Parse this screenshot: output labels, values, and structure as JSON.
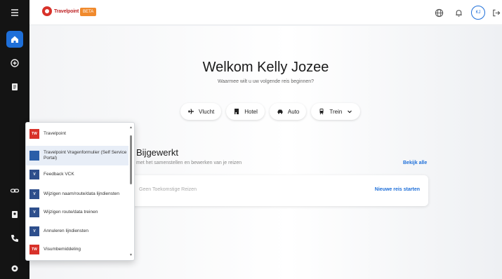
{
  "header": {
    "logo_text": "Travelpoint",
    "beta_badge": "BETA",
    "avatar_initials": "KJ"
  },
  "main": {
    "welcome": "Welkom Kelly Jozee",
    "subtitle": "Waarmee wilt u uw volgende reis beginnen?",
    "transport_options": [
      {
        "label": "Vlucht",
        "icon": "plane-icon"
      },
      {
        "label": "Hotel",
        "icon": "hotel-icon"
      },
      {
        "label": "Auto",
        "icon": "car-icon"
      },
      {
        "label": "Trein",
        "icon": "train-icon"
      }
    ],
    "section_title": "Bijgewerkt",
    "section_subtitle": "met het samenstellen en bewerken van je reizen",
    "view_all": "Bekijk alle",
    "trips_empty": "Geen Toekomstige Reizen",
    "new_trip": "Nieuwe reis starten"
  },
  "dropdown": {
    "items": [
      {
        "label": "Travelpoint",
        "icon": "TW",
        "color": "red"
      },
      {
        "label": "Travelpoint Vragenformulier (Self Service Portal)",
        "icon": "",
        "color": "blue"
      },
      {
        "label": "Feedback VCK",
        "icon": "V",
        "color": "navy"
      },
      {
        "label": "Wijzigen naam/route/data lijndiensten",
        "icon": "V",
        "color": "navy"
      },
      {
        "label": "Wijzigen route/data treinen",
        "icon": "V",
        "color": "navy"
      },
      {
        "label": "Annuleren lijndiensten",
        "icon": "V",
        "color": "navy"
      },
      {
        "label": "Visumbemiddeling",
        "icon": "TW",
        "color": "red"
      }
    ]
  }
}
